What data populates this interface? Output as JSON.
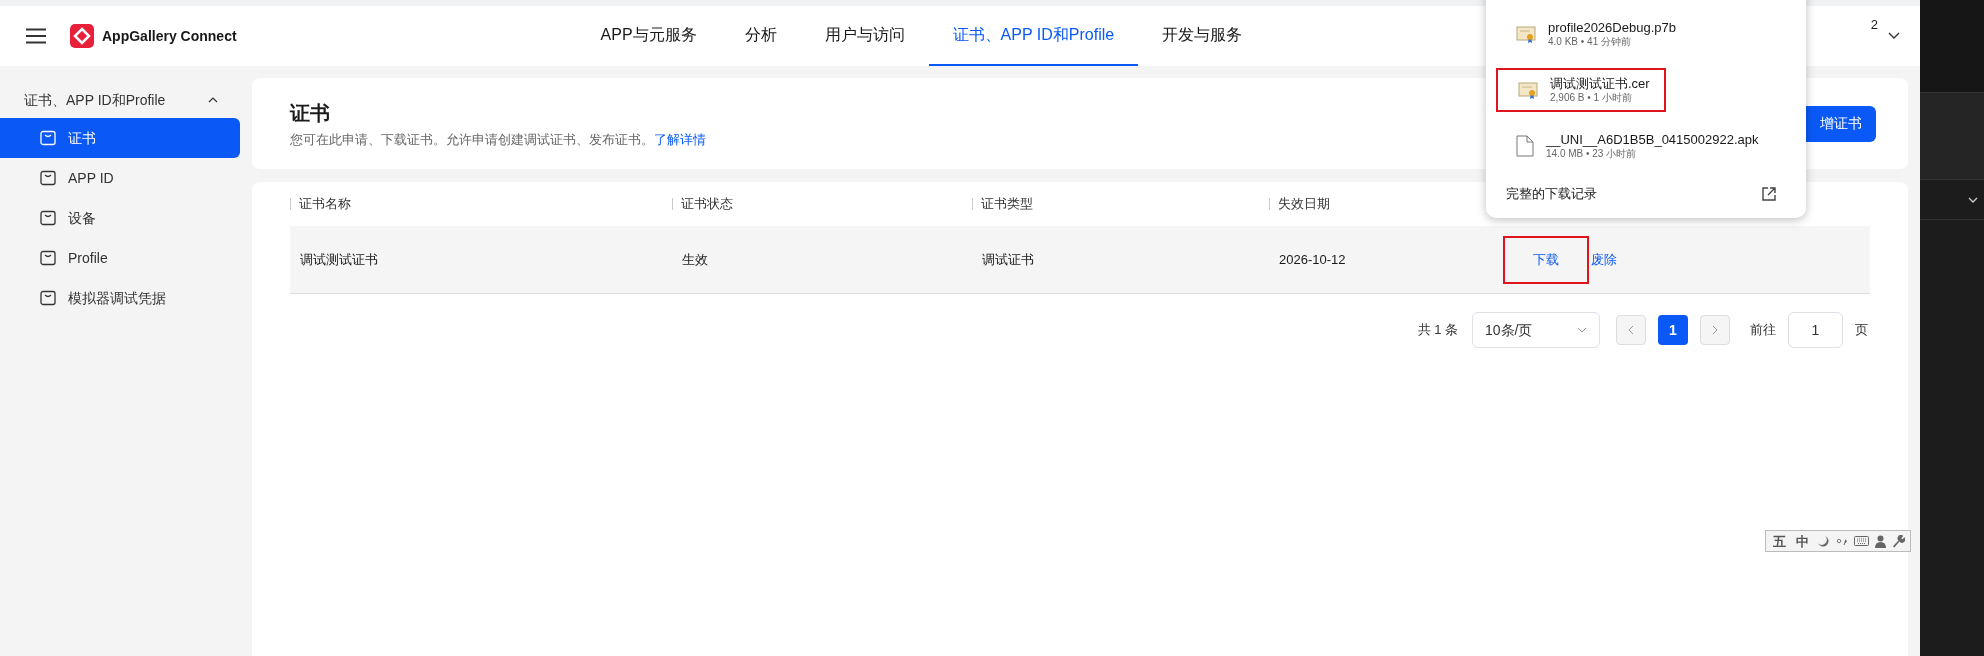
{
  "header": {
    "app_name": "AppGallery Connect",
    "nav_tabs": [
      {
        "label": "APP与元服务",
        "selected": false
      },
      {
        "label": "分析",
        "selected": false
      },
      {
        "label": "用户与访问",
        "selected": false
      },
      {
        "label": "证书、APP ID和Profile",
        "selected": true
      },
      {
        "label": "开发与服务",
        "selected": false
      }
    ],
    "account_fragment": "2"
  },
  "sidebar": {
    "group": {
      "label": "证书、APP ID和Profile",
      "expanded": true,
      "items": [
        {
          "label": "证书",
          "selected": true
        },
        {
          "label": "APP ID",
          "selected": false
        },
        {
          "label": "设备",
          "selected": false
        },
        {
          "label": "Profile",
          "selected": false
        },
        {
          "label": "模拟器调试凭据",
          "selected": false
        }
      ]
    }
  },
  "page": {
    "title": "证书",
    "description": "您可在此申请、下载证书。允许申请创建调试证书、发布证书。",
    "learn_more": "了解详情",
    "add_button": "增证书"
  },
  "table": {
    "columns": [
      "证书名称",
      "证书状态",
      "证书类型",
      "失效日期"
    ],
    "rows": [
      {
        "cells": [
          "调试测试证书",
          "生效",
          "调试证书",
          "2026-10-12"
        ],
        "actions": [
          {
            "label": "下载",
            "highlighted": true
          },
          {
            "label": "废除",
            "highlighted": false
          }
        ]
      }
    ]
  },
  "pagination": {
    "total": "共 1 条",
    "page_size": "10条/页",
    "pages": [
      {
        "label": "1",
        "selected": true
      }
    ],
    "goto_label": "前往",
    "goto_value": "1",
    "page_suffix": "页"
  },
  "downloads_popup": {
    "items": [
      {
        "kind": "certificate",
        "name": "profile2026Debug.p7b",
        "meta": "4.0 KB • 41 分钟前",
        "highlighted": false
      },
      {
        "kind": "certificate",
        "name": "调试测试证书.cer",
        "meta": "2,906 B • 1 小时前",
        "highlighted": true
      },
      {
        "kind": "file",
        "name": "__UNI__A6D1B5B_0415002922.apk",
        "meta": "14.0 MB • 23 小时前",
        "highlighted": false
      }
    ],
    "footer": "完整的下载记录"
  },
  "ime_toolbar": {
    "items": [
      {
        "kind": "text",
        "label": "五"
      },
      {
        "kind": "text",
        "label": "中"
      },
      {
        "kind": "moon"
      },
      {
        "kind": "punctuation"
      },
      {
        "kind": "keyboard"
      },
      {
        "kind": "person"
      },
      {
        "kind": "wrench"
      }
    ]
  }
}
